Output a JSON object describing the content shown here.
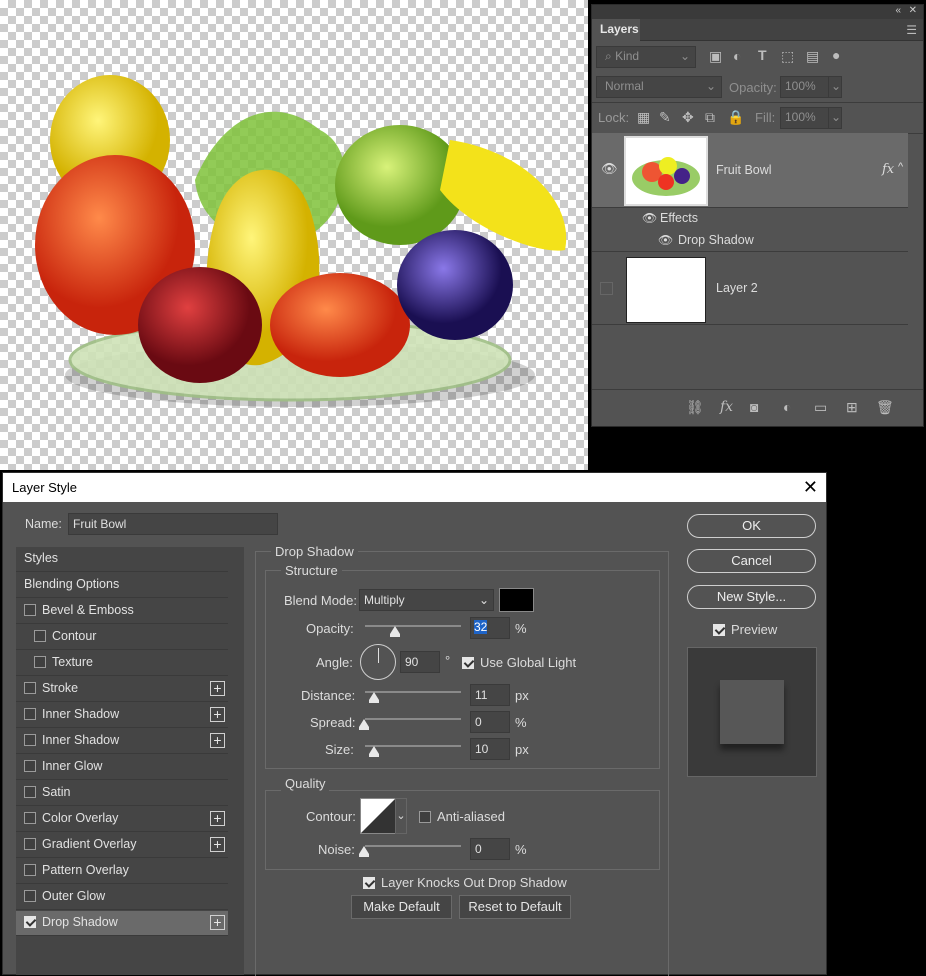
{
  "layers_panel": {
    "tab_label": "Layers",
    "filter_kind": "Kind",
    "blend_mode": "Normal",
    "opacity_label": "Opacity:",
    "opacity_value": "100%",
    "lock_label": "Lock:",
    "fill_label": "Fill:",
    "fill_value": "100%",
    "layers": [
      {
        "name": "Fruit Bowl",
        "fx": "fx",
        "effects_label": "Effects",
        "effect": "Drop Shadow"
      },
      {
        "name": "Layer 2"
      }
    ]
  },
  "dialog": {
    "title": "Layer Style",
    "name_label": "Name:",
    "name_value": "Fruit Bowl",
    "buttons": {
      "ok": "OK",
      "cancel": "Cancel",
      "new_style": "New Style...",
      "preview": "Preview"
    },
    "style_list": [
      {
        "label": "Styles",
        "checkbox": false,
        "plus": false,
        "indent": false
      },
      {
        "label": "Blending Options",
        "checkbox": false,
        "plus": false,
        "indent": false
      },
      {
        "label": "Bevel & Emboss",
        "checkbox": true,
        "checked": false,
        "plus": false,
        "indent": false
      },
      {
        "label": "Contour",
        "checkbox": true,
        "checked": false,
        "plus": false,
        "indent": true
      },
      {
        "label": "Texture",
        "checkbox": true,
        "checked": false,
        "plus": false,
        "indent": true
      },
      {
        "label": "Stroke",
        "checkbox": true,
        "checked": false,
        "plus": true,
        "indent": false
      },
      {
        "label": "Inner Shadow",
        "checkbox": true,
        "checked": false,
        "plus": true,
        "indent": false
      },
      {
        "label": "Inner Shadow",
        "checkbox": true,
        "checked": false,
        "plus": true,
        "indent": false
      },
      {
        "label": "Inner Glow",
        "checkbox": true,
        "checked": false,
        "plus": false,
        "indent": false
      },
      {
        "label": "Satin",
        "checkbox": true,
        "checked": false,
        "plus": false,
        "indent": false
      },
      {
        "label": "Color Overlay",
        "checkbox": true,
        "checked": false,
        "plus": true,
        "indent": false
      },
      {
        "label": "Gradient Overlay",
        "checkbox": true,
        "checked": false,
        "plus": true,
        "indent": false
      },
      {
        "label": "Pattern Overlay",
        "checkbox": true,
        "checked": false,
        "plus": false,
        "indent": false
      },
      {
        "label": "Outer Glow",
        "checkbox": true,
        "checked": false,
        "plus": false,
        "indent": false
      },
      {
        "label": "Drop Shadow",
        "checkbox": true,
        "checked": true,
        "plus": true,
        "indent": false,
        "selected": true
      }
    ],
    "drop_shadow": {
      "section_title": "Drop Shadow",
      "structure_title": "Structure",
      "blend_mode_label": "Blend Mode:",
      "blend_mode_value": "Multiply",
      "shadow_color": "#000000",
      "opacity_label": "Opacity:",
      "opacity_value": "32",
      "opacity_unit": "%",
      "angle_label": "Angle:",
      "angle_value": "90",
      "angle_unit": "°",
      "use_global_light": "Use Global Light",
      "distance_label": "Distance:",
      "distance_value": "11",
      "distance_unit": "px",
      "spread_label": "Spread:",
      "spread_value": "0",
      "spread_unit": "%",
      "size_label": "Size:",
      "size_value": "10",
      "size_unit": "px",
      "quality_title": "Quality",
      "contour_label": "Contour:",
      "anti_aliased": "Anti-aliased",
      "noise_label": "Noise:",
      "noise_value": "0",
      "noise_unit": "%",
      "knockout": "Layer Knocks Out Drop Shadow",
      "make_default": "Make Default",
      "reset_default": "Reset to Default"
    }
  }
}
